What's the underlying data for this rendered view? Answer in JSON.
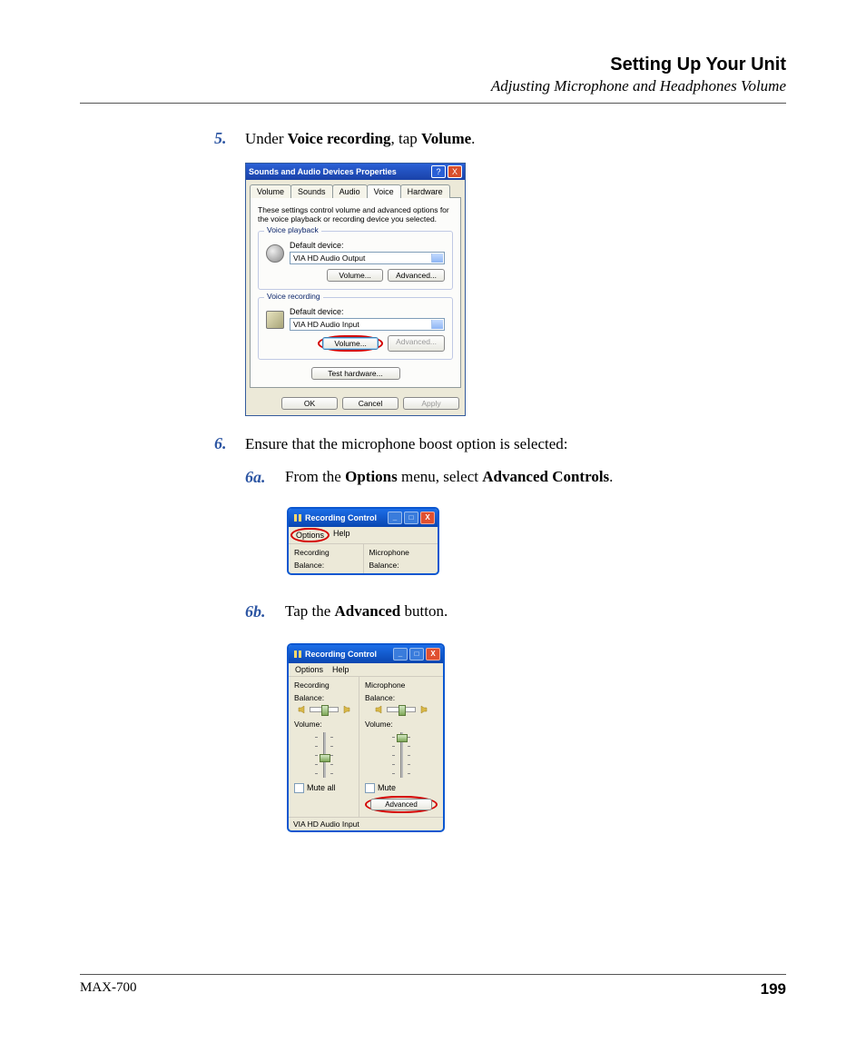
{
  "header": {
    "title": "Setting Up Your Unit",
    "subtitle": "Adjusting Microphone and Headphones Volume"
  },
  "steps": {
    "s5": {
      "num": "5.",
      "text_before": "Under ",
      "bold1": "Voice recording",
      "text_mid": ", tap ",
      "bold2": "Volume",
      "text_after": "."
    },
    "s6": {
      "num": "6.",
      "text": "Ensure that the microphone boost option is selected:"
    },
    "s6a": {
      "num": "6a.",
      "text_before": "From the ",
      "bold1": "Options",
      "text_mid": " menu, select ",
      "bold2": "Advanced Controls",
      "text_after": "."
    },
    "s6b": {
      "num": "6b.",
      "text_before": "Tap the ",
      "bold1": "Advanced",
      "text_after": " button."
    }
  },
  "shot1": {
    "title": "Sounds and Audio Devices Properties",
    "help_icon": "?",
    "close_icon": "X",
    "tabs": [
      "Volume",
      "Sounds",
      "Audio",
      "Voice",
      "Hardware"
    ],
    "active_tab": "Voice",
    "desc": "These settings control volume and advanced options for the voice playback or recording device you selected.",
    "playback": {
      "legend": "Voice playback",
      "label": "Default device:",
      "device": "VIA HD Audio Output",
      "volume_btn": "Volume...",
      "advanced_btn": "Advanced..."
    },
    "recording": {
      "legend": "Voice recording",
      "label": "Default device:",
      "device": "VIA HD Audio Input",
      "volume_btn": "Volume...",
      "advanced_btn": "Advanced..."
    },
    "test_btn": "Test hardware...",
    "ok": "OK",
    "cancel": "Cancel",
    "apply": "Apply"
  },
  "shot2": {
    "title": "Recording Control",
    "menu_options": "Options",
    "menu_help": "Help",
    "col1_hdr": "Recording",
    "col2_hdr": "Microphone",
    "balance_label": "Balance:"
  },
  "shot3": {
    "title": "Recording Control",
    "menu_options": "Options",
    "menu_help": "Help",
    "col1": {
      "hdr": "Recording",
      "balance": "Balance:",
      "volume": "Volume:",
      "mute": "Mute all"
    },
    "col2": {
      "hdr": "Microphone",
      "balance": "Balance:",
      "volume": "Volume:",
      "mute": "Mute",
      "advanced": "Advanced"
    },
    "status": "VIA HD Audio Input"
  },
  "footer": {
    "product": "MAX-700",
    "page": "199"
  }
}
